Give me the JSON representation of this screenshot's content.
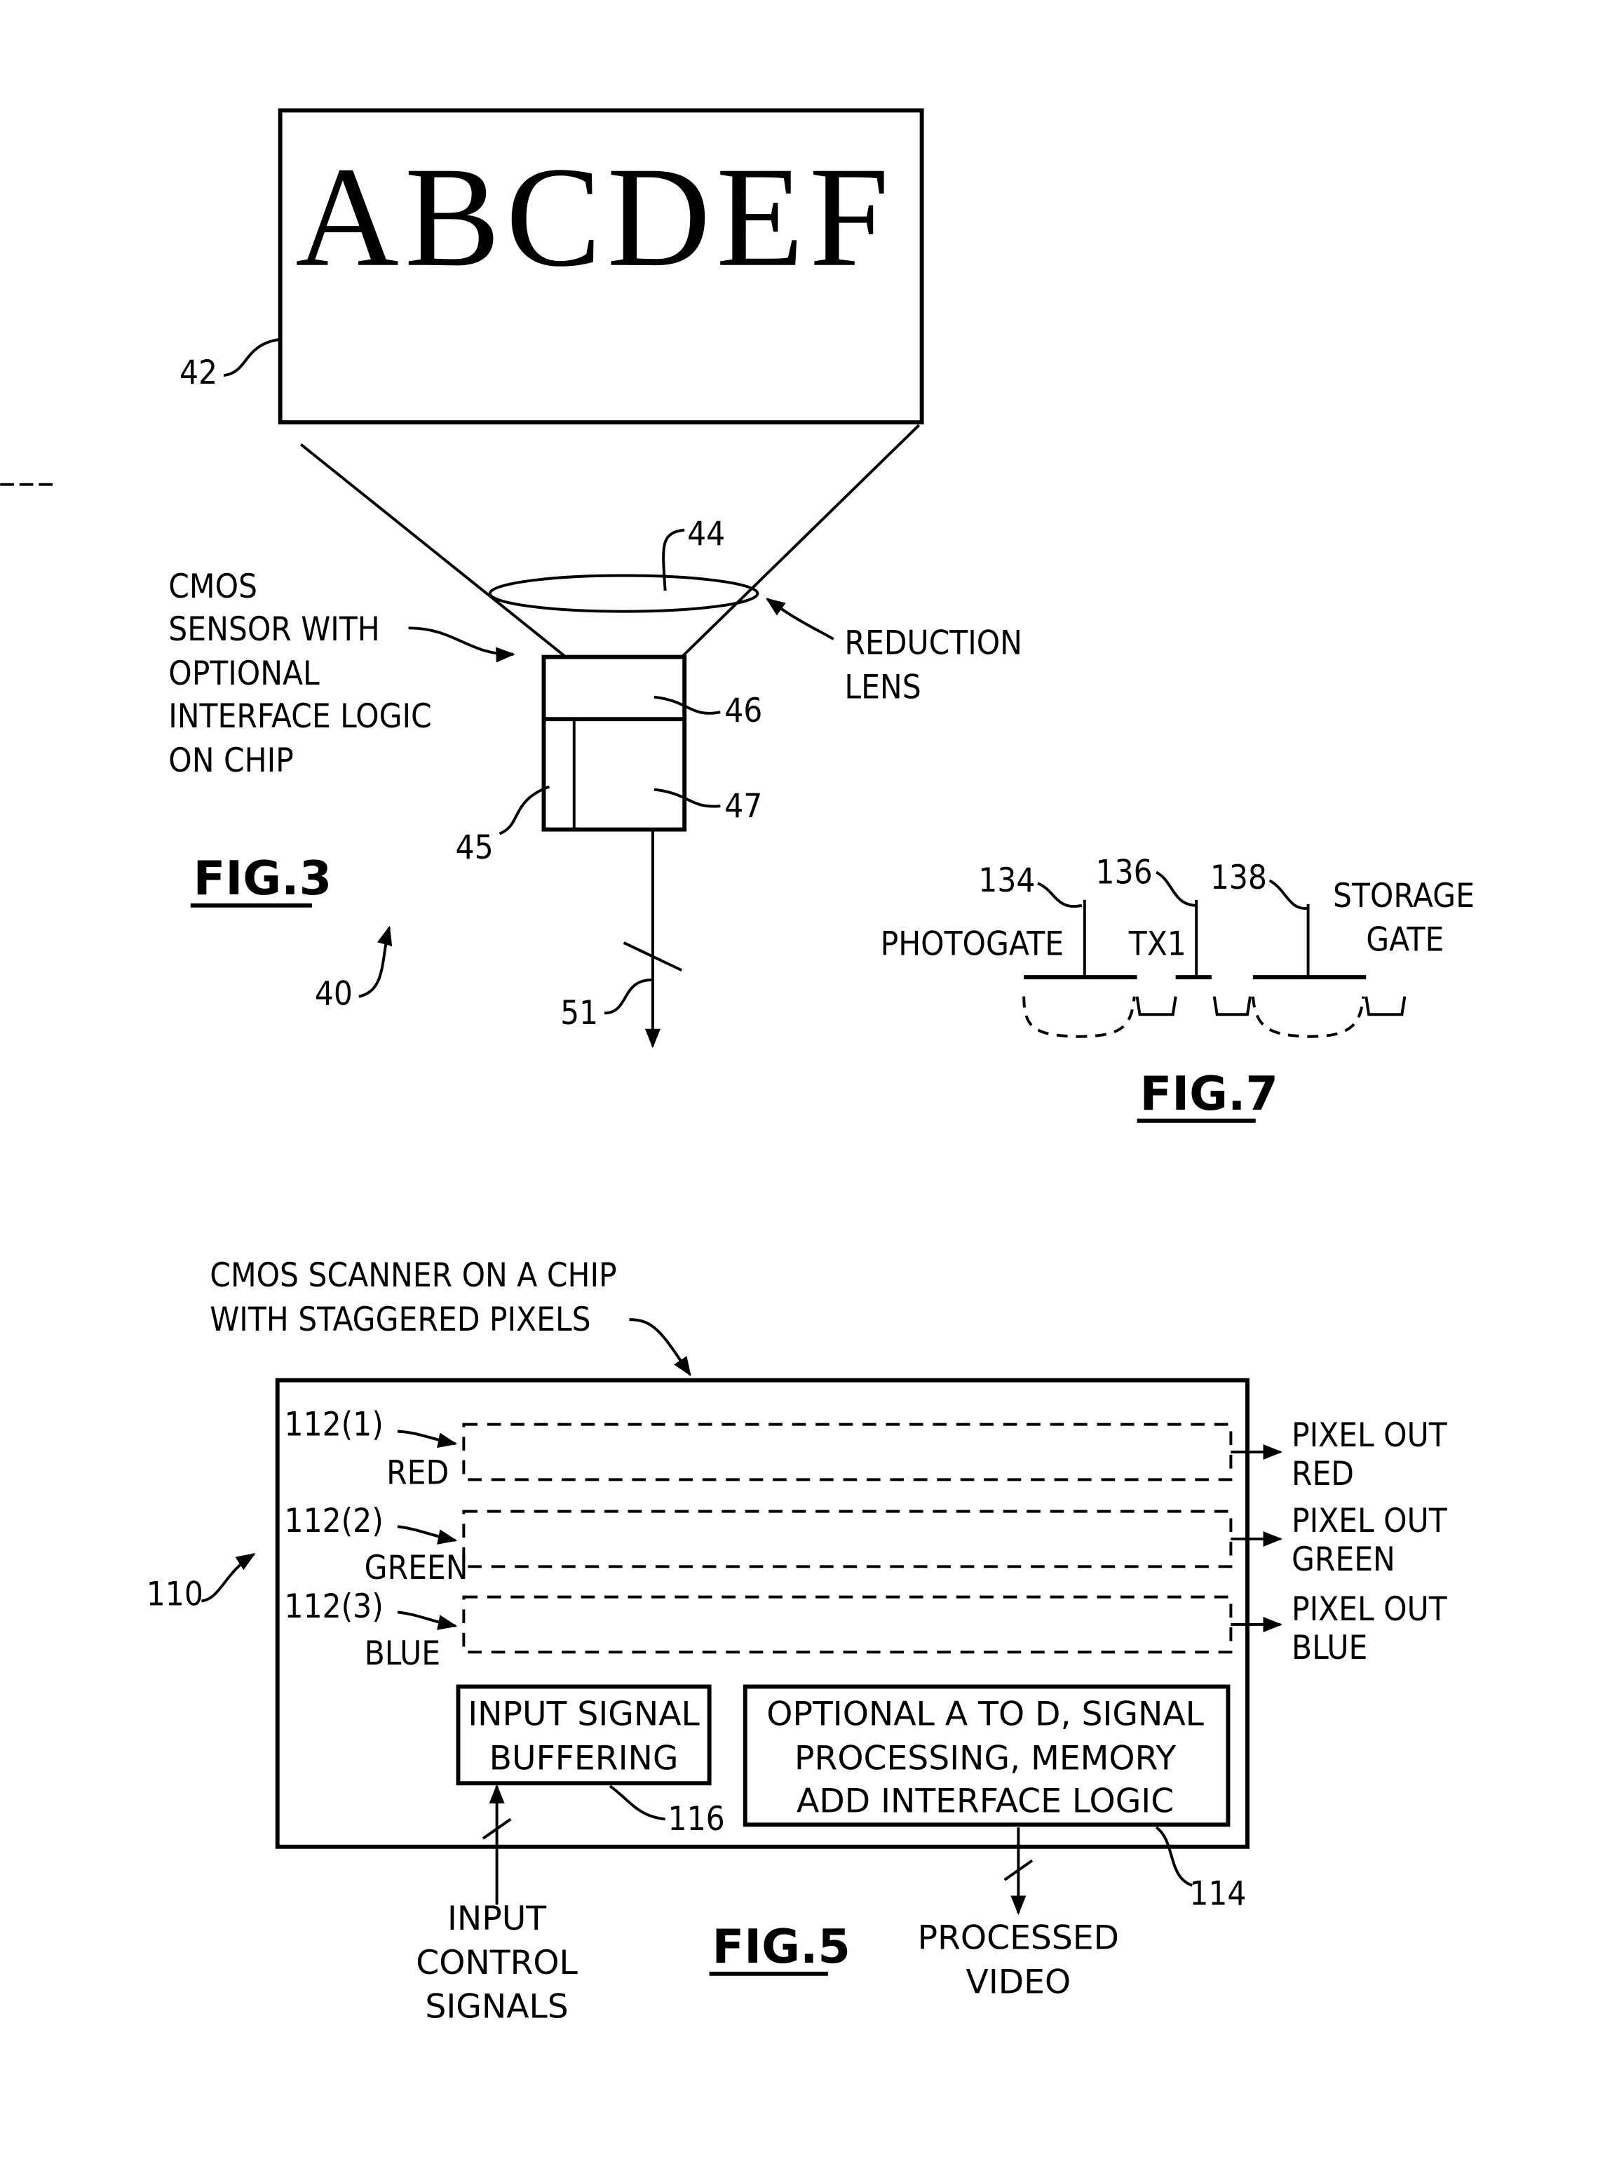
{
  "fig3": {
    "title": "FIG.3",
    "document_text": "ABCDEF",
    "refs": {
      "document": "42",
      "lens": "44",
      "sensor_top": "46",
      "sensor_bottom_right": "47",
      "sensor_bottom_left": "45",
      "system": "40",
      "output_bus": "51"
    },
    "sensor_label": [
      "CMOS",
      "SENSOR  WITH",
      "OPTIONAL",
      "INTERFACE  LOGIC",
      "ON  CHIP"
    ],
    "lens_label": [
      "REDUCTION",
      "LENS"
    ]
  },
  "fig7": {
    "title": "FIG.7",
    "refs": {
      "photogate": "134",
      "tx1": "136",
      "storage_gate": "138"
    },
    "labels": {
      "photogate": "PHOTOGATE",
      "tx1": "TX1",
      "storage_line1": "STORAGE",
      "storage_line2": "GATE"
    }
  },
  "fig5": {
    "title": "FIG.5",
    "header": [
      "CMOS  SCANNER  ON  A  CHIP",
      "WITH  STAGGERED  PIXELS"
    ],
    "chip_ref": "110",
    "rows": [
      {
        "ref": "112(1)",
        "color": "RED",
        "out1": "PIXEL  OUT",
        "out2": "RED"
      },
      {
        "ref": "112(2)",
        "color": "GREEN",
        "out1": "PIXEL  OUT",
        "out2": "GREEN"
      },
      {
        "ref": "112(3)",
        "color": "BLUE",
        "out1": "PIXEL  OUT",
        "out2": "BLUE"
      }
    ],
    "buffer": {
      "line1": "INPUT  SIGNAL",
      "line2": "BUFFERING",
      "ref": "116"
    },
    "processing": {
      "line1": "OPTIONAL  A  TO  D,  SIGNAL",
      "line2": "PROCESSING,  MEMORY",
      "line3": "ADD  INTERFACE  LOGIC",
      "ref": "114"
    },
    "input_label": [
      "INPUT",
      "CONTROL",
      "SIGNALS"
    ],
    "output_label": [
      "PROCESSED",
      "VIDEO"
    ]
  }
}
